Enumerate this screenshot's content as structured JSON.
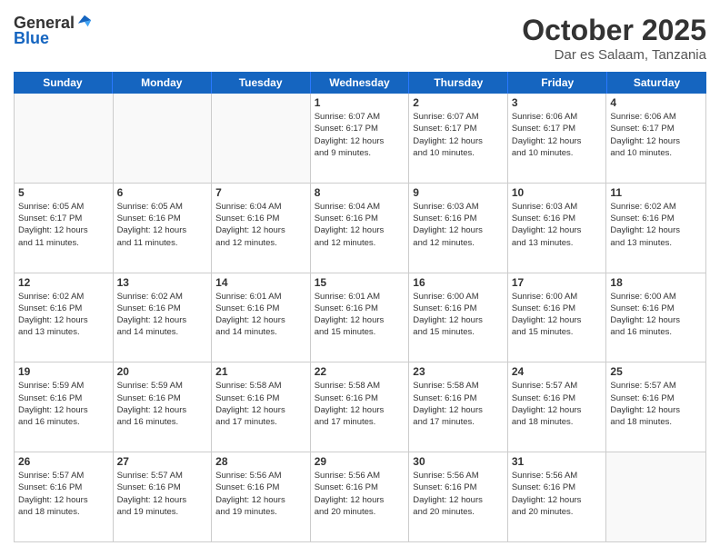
{
  "header": {
    "logo_line1": "General",
    "logo_line2": "Blue",
    "month_year": "October 2025",
    "location": "Dar es Salaam, Tanzania"
  },
  "weekdays": [
    "Sunday",
    "Monday",
    "Tuesday",
    "Wednesday",
    "Thursday",
    "Friday",
    "Saturday"
  ],
  "rows": [
    [
      {
        "day": "",
        "info": ""
      },
      {
        "day": "",
        "info": ""
      },
      {
        "day": "",
        "info": ""
      },
      {
        "day": "1",
        "info": "Sunrise: 6:07 AM\nSunset: 6:17 PM\nDaylight: 12 hours\nand 9 minutes."
      },
      {
        "day": "2",
        "info": "Sunrise: 6:07 AM\nSunset: 6:17 PM\nDaylight: 12 hours\nand 10 minutes."
      },
      {
        "day": "3",
        "info": "Sunrise: 6:06 AM\nSunset: 6:17 PM\nDaylight: 12 hours\nand 10 minutes."
      },
      {
        "day": "4",
        "info": "Sunrise: 6:06 AM\nSunset: 6:17 PM\nDaylight: 12 hours\nand 10 minutes."
      }
    ],
    [
      {
        "day": "5",
        "info": "Sunrise: 6:05 AM\nSunset: 6:17 PM\nDaylight: 12 hours\nand 11 minutes."
      },
      {
        "day": "6",
        "info": "Sunrise: 6:05 AM\nSunset: 6:16 PM\nDaylight: 12 hours\nand 11 minutes."
      },
      {
        "day": "7",
        "info": "Sunrise: 6:04 AM\nSunset: 6:16 PM\nDaylight: 12 hours\nand 12 minutes."
      },
      {
        "day": "8",
        "info": "Sunrise: 6:04 AM\nSunset: 6:16 PM\nDaylight: 12 hours\nand 12 minutes."
      },
      {
        "day": "9",
        "info": "Sunrise: 6:03 AM\nSunset: 6:16 PM\nDaylight: 12 hours\nand 12 minutes."
      },
      {
        "day": "10",
        "info": "Sunrise: 6:03 AM\nSunset: 6:16 PM\nDaylight: 12 hours\nand 13 minutes."
      },
      {
        "day": "11",
        "info": "Sunrise: 6:02 AM\nSunset: 6:16 PM\nDaylight: 12 hours\nand 13 minutes."
      }
    ],
    [
      {
        "day": "12",
        "info": "Sunrise: 6:02 AM\nSunset: 6:16 PM\nDaylight: 12 hours\nand 13 minutes."
      },
      {
        "day": "13",
        "info": "Sunrise: 6:02 AM\nSunset: 6:16 PM\nDaylight: 12 hours\nand 14 minutes."
      },
      {
        "day": "14",
        "info": "Sunrise: 6:01 AM\nSunset: 6:16 PM\nDaylight: 12 hours\nand 14 minutes."
      },
      {
        "day": "15",
        "info": "Sunrise: 6:01 AM\nSunset: 6:16 PM\nDaylight: 12 hours\nand 15 minutes."
      },
      {
        "day": "16",
        "info": "Sunrise: 6:00 AM\nSunset: 6:16 PM\nDaylight: 12 hours\nand 15 minutes."
      },
      {
        "day": "17",
        "info": "Sunrise: 6:00 AM\nSunset: 6:16 PM\nDaylight: 12 hours\nand 15 minutes."
      },
      {
        "day": "18",
        "info": "Sunrise: 6:00 AM\nSunset: 6:16 PM\nDaylight: 12 hours\nand 16 minutes."
      }
    ],
    [
      {
        "day": "19",
        "info": "Sunrise: 5:59 AM\nSunset: 6:16 PM\nDaylight: 12 hours\nand 16 minutes."
      },
      {
        "day": "20",
        "info": "Sunrise: 5:59 AM\nSunset: 6:16 PM\nDaylight: 12 hours\nand 16 minutes."
      },
      {
        "day": "21",
        "info": "Sunrise: 5:58 AM\nSunset: 6:16 PM\nDaylight: 12 hours\nand 17 minutes."
      },
      {
        "day": "22",
        "info": "Sunrise: 5:58 AM\nSunset: 6:16 PM\nDaylight: 12 hours\nand 17 minutes."
      },
      {
        "day": "23",
        "info": "Sunrise: 5:58 AM\nSunset: 6:16 PM\nDaylight: 12 hours\nand 17 minutes."
      },
      {
        "day": "24",
        "info": "Sunrise: 5:57 AM\nSunset: 6:16 PM\nDaylight: 12 hours\nand 18 minutes."
      },
      {
        "day": "25",
        "info": "Sunrise: 5:57 AM\nSunset: 6:16 PM\nDaylight: 12 hours\nand 18 minutes."
      }
    ],
    [
      {
        "day": "26",
        "info": "Sunrise: 5:57 AM\nSunset: 6:16 PM\nDaylight: 12 hours\nand 18 minutes."
      },
      {
        "day": "27",
        "info": "Sunrise: 5:57 AM\nSunset: 6:16 PM\nDaylight: 12 hours\nand 19 minutes."
      },
      {
        "day": "28",
        "info": "Sunrise: 5:56 AM\nSunset: 6:16 PM\nDaylight: 12 hours\nand 19 minutes."
      },
      {
        "day": "29",
        "info": "Sunrise: 5:56 AM\nSunset: 6:16 PM\nDaylight: 12 hours\nand 20 minutes."
      },
      {
        "day": "30",
        "info": "Sunrise: 5:56 AM\nSunset: 6:16 PM\nDaylight: 12 hours\nand 20 minutes."
      },
      {
        "day": "31",
        "info": "Sunrise: 5:56 AM\nSunset: 6:16 PM\nDaylight: 12 hours\nand 20 minutes."
      },
      {
        "day": "",
        "info": ""
      }
    ]
  ]
}
